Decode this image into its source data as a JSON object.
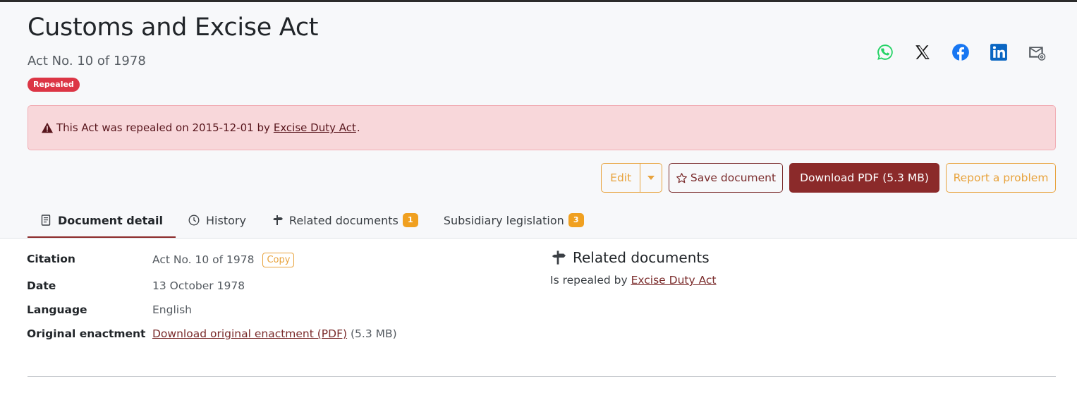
{
  "header": {
    "title": "Customs and Excise Act",
    "subtitle": "Act No. 10 of 1978",
    "status_badge": "Repealed"
  },
  "share": {
    "icons": [
      "whatsapp-icon",
      "x-twitter-icon",
      "facebook-icon",
      "linkedin-icon",
      "email-icon"
    ],
    "colors": {
      "whatsapp": "#25d366",
      "x": "#111111",
      "facebook": "#1877f2",
      "linkedin": "#0a66c2",
      "email": "#555b61"
    }
  },
  "alert": {
    "text_before": "This Act was repealed on 2015-12-01 by",
    "link": "Excise Duty Act",
    "text_after": "."
  },
  "actions": {
    "edit_label": "Edit",
    "save_label": "Save document",
    "download_label": "Download PDF (5.3  MB)",
    "report_label": "Report a problem"
  },
  "tabs": [
    {
      "label": "Document detail",
      "active": true
    },
    {
      "label": "History"
    },
    {
      "label": "Related documents",
      "count": "1"
    },
    {
      "label": "Subsidiary legislation",
      "count": "3"
    }
  ],
  "details": {
    "citation_label": "Citation",
    "citation_value": "Act No. 10 of 1978",
    "copy_label": "Copy",
    "date_label": "Date",
    "date_value": "13 October 1978",
    "language_label": "Language",
    "language_value": "English",
    "original_label": "Original enactment",
    "original_link": "Download original enactment (PDF)",
    "original_size": "(5.3  MB)"
  },
  "related": {
    "title": "Related documents",
    "text": "Is repealed by",
    "link": "Excise Duty Act"
  },
  "colors": {
    "accent": "#8b2a2a",
    "warning": "#e8a33d",
    "danger": "#dc3545",
    "alert_bg": "#f8d7da"
  }
}
